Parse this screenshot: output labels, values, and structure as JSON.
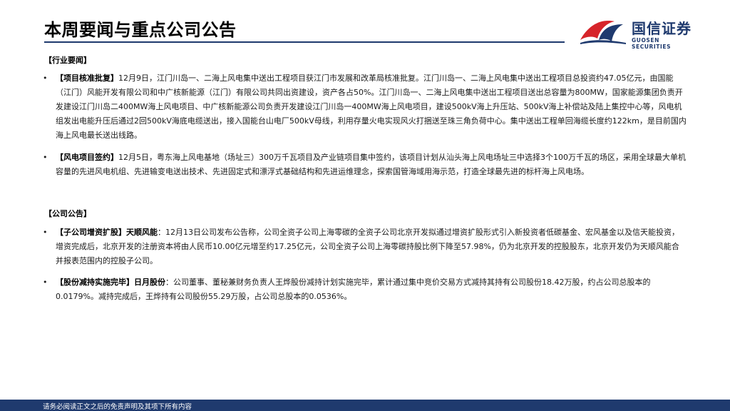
{
  "header": {
    "title": "本周要闻与重点公司公告",
    "logo": {
      "name_cn": "国信证券",
      "name_en": "GUOSEN SECURITIES",
      "colors": {
        "navy": "#1f3a6e",
        "red": "#d6242a"
      }
    }
  },
  "industry": {
    "heading": "【行业要闻】",
    "items": [
      {
        "tag": "【项目核准批复】",
        "text": "12月9日，江门川岛一、二海上风电集中送出工程项目获江门市发展和改革局核准批复。江门川岛一、二海上风电集中送出工程项目总投资约47.05亿元，由国能（江门）风能开发有限公司和中广核新能源（江门）有限公司共同出资建设，资产各占50%。江门川岛一、二海上风电集中送出工程项目送出总容量为800MW，国家能源集团负责开发建设江门川岛二400MW海上风电项目、中广核新能源公司负责开发建设江门川岛一400MW海上风电项目，建设500kV海上升压站、500kV海上补偿站及陆上集控中心等，风电机组发出电能升压后通过2回500kV海底电缆送出，接入国能台山电厂500kV母线，利用存量火电实现风火打捆送至珠三角负荷中心。集中送出工程单回海缆长度约122km，是目前国内海上风电最长送出线路。"
      },
      {
        "tag": "【风电项目签约】",
        "text": "12月5日，粤东海上风电基地（场址三）300万千瓦项目及产业链项目集中签约，该项目计划从汕头海上风电场址三中选择3个100万千瓦的场区，采用全球最大单机容量的先进风电机组、先进输变电送出技术、先进固定式和漂浮式基础结构和先进运维理念，探索国管海域用海示范，打造全球最先进的标杆海上风电场。"
      }
    ]
  },
  "company": {
    "heading": "【公司公告】",
    "items": [
      {
        "tag": "【子公司增资扩股】天顺风能",
        "text": "：12月13日公司发布公告称，公司全资子公司上海零碳的全资子公司北京开发拟通过增资扩股形式引入新投资者低碳基金、宏风基金以及信天能投资，增资完成后，北京开发的注册资本将由人民币10.00亿元增至约17.25亿元，公司全资子公司上海零碳持股比例下降至57.98%，仍为北京开发的控股股东，北京开发仍为天顺风能合并报表范围内的控股子公司。"
      },
      {
        "tag": "【股份减持实施完毕】日月股份",
        "text": "：公司董事、董秘兼财务负责人王烨股份减持计划实施完毕，累计通过集中竞价交易方式减持其持有公司股份18.42万股，约占公司总股本的0.0179%。减持完成后，王烨持有公司股份55.29万股，占公司总股本的0.0536%。"
      }
    ]
  },
  "footer": {
    "disclaimer": "请务必阅读正文之后的免责声明及其项下所有内容",
    "bar_color": "#1f3a6e"
  }
}
